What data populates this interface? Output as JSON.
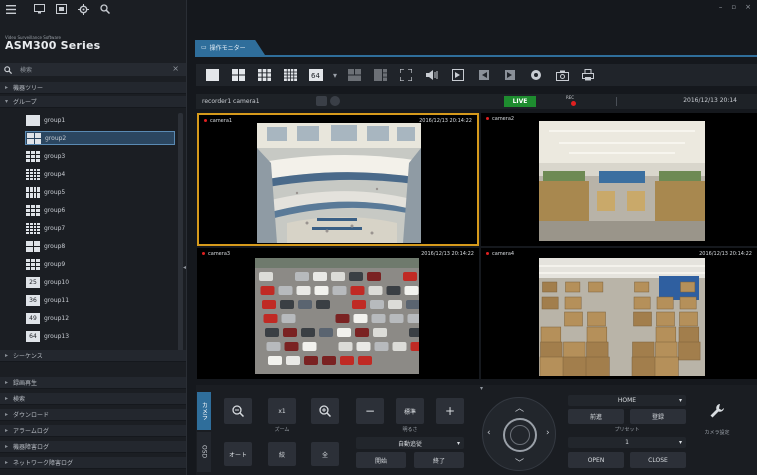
{
  "app": {
    "subtitle": "Video Surveillance Software",
    "title": "ASM300 Series"
  },
  "window": {
    "minimize": "–",
    "maximize": "▫",
    "close": "×"
  },
  "search": {
    "label": "検索",
    "close": "×"
  },
  "sidebar": {
    "device_tree": "機器ツリー",
    "group": "グループ",
    "groups": [
      "group1",
      "group2",
      "group3",
      "group4",
      "group5",
      "group6",
      "group7",
      "group8",
      "group9",
      "group10",
      "group11",
      "group12",
      "group13"
    ],
    "selected_group": "group2",
    "sequence": "シーケンス",
    "bottom_sections": [
      "録画再生",
      "検索",
      "ダウンロード",
      "アラームログ",
      "機器障害ログ",
      "ネットワーク障害ログ"
    ]
  },
  "tab": {
    "label": "操作モニター"
  },
  "infobar": {
    "camera": "recorder1 camera1",
    "live": "LIVE",
    "rec": "REC",
    "datetime": "2016/12/13 20:14"
  },
  "cameras": [
    {
      "name": "camera1",
      "timestamp": "2016/12/13 20:14:22"
    },
    {
      "name": "camera2",
      "timestamp": ""
    },
    {
      "name": "camera3",
      "timestamp": "2016/12/13 20:14:22"
    },
    {
      "name": "camera4",
      "timestamp": "2016/12/13 20:14:22"
    }
  ],
  "controls": {
    "tab_camera": "カメラ",
    "tab_osd": "OSD",
    "zoom_x1": "x1",
    "zoom_label": "ズーム",
    "focus_minus": "−",
    "focus_std": "標準",
    "focus_plus": "+",
    "focus_label": "明るさ",
    "auto_label": "オート",
    "auto_mid": "絞",
    "auto_right": "全",
    "auto_focus": "自動追従",
    "start": "開始",
    "end": "終了",
    "home": "HOME",
    "preset_prev": "前進",
    "preset_next": "登録",
    "preset_label": "プリセット",
    "preset_value": "1",
    "open": "OPEN",
    "close": "CLOSE",
    "camera_setting": "カメラ設定"
  },
  "colors": {
    "accent": "#2f6e9b",
    "live": "#1e8c2f",
    "rec": "#e02020",
    "selected_border": "#d69a1c"
  }
}
